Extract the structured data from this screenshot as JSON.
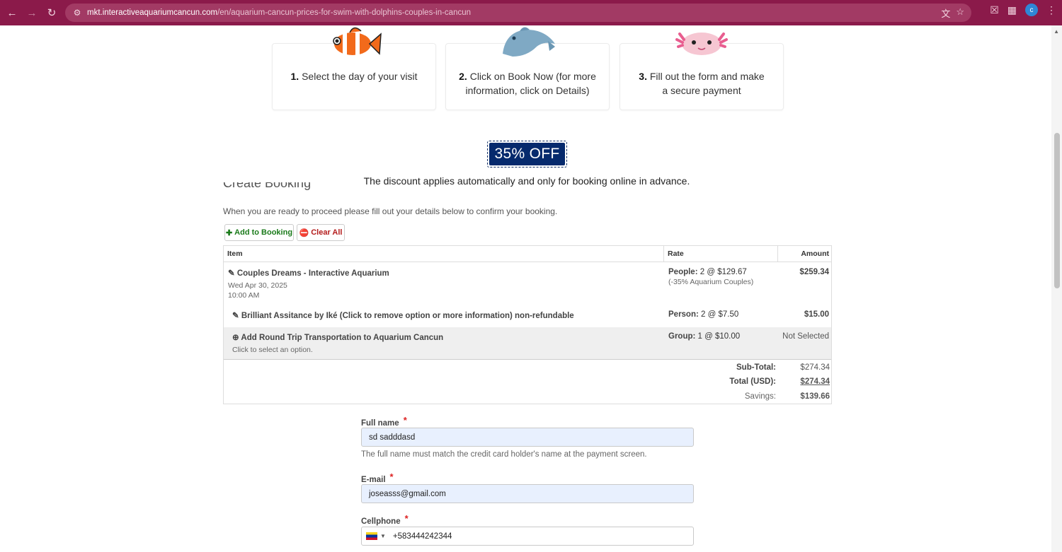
{
  "browser": {
    "url_host": "mkt.interactiveaquariumcancun.com",
    "url_path": "/en/aquarium-cancun-prices-for-swim-with-dolphins-couples-in-cancun",
    "profile_initial": "c"
  },
  "steps": [
    {
      "number": "1.",
      "text": "Select the day of your visit"
    },
    {
      "number": "2.",
      "text": "Click on Book Now (for more information, click on Details)"
    },
    {
      "number": "3.",
      "text": "Fill out the form and make a secure payment"
    }
  ],
  "promo": {
    "badge": "35% OFF",
    "note": "The discount applies automatically and only for booking online in advance."
  },
  "booking": {
    "heading": "Create Booking",
    "intro": "When you are ready to proceed please fill out your details below to confirm your booking.",
    "add_button": "Add to Booking",
    "clear_button": "Clear All",
    "columns": {
      "item": "Item",
      "rate": "Rate",
      "amount": "Amount"
    },
    "rows": [
      {
        "title": "Couples Dreams - Interactive Aquarium",
        "date": "Wed Apr 30, 2025",
        "time": "10:00 AM",
        "rate_label": "People:",
        "rate_value": "2 @ $129.67",
        "rate_note": "(-35% Aquarium Couples)",
        "amount": "$259.34"
      },
      {
        "title": "Brilliant Assitance by Iké (Click to remove option or more information) non-refundable",
        "rate_label": "Person:",
        "rate_value": "2 @ $7.50",
        "amount": "$15.00"
      },
      {
        "title": "Add Round Trip Transportation to Aquarium Cancun",
        "subtitle": "Click to select an option.",
        "rate_label": "Group:",
        "rate_value": "1 @ $10.00",
        "amount": "Not Selected"
      }
    ],
    "totals": {
      "subtotal_label": "Sub-Total:",
      "subtotal": "$274.34",
      "total_label": "Total (USD):",
      "total": "$274.34",
      "savings_label": "Savings:",
      "savings": "$139.66"
    }
  },
  "form": {
    "full_name_label": "Full name",
    "full_name_value": "sd sadddasd",
    "full_name_help": "The full name must match the credit card holder's name at the payment screen.",
    "email_label": "E-mail",
    "email_value": "joseasss@gmail.com",
    "cellphone_label": "Cellphone",
    "cellphone_value": "+583444242344",
    "required_mark": "*"
  },
  "colors": {
    "chrome": "#8b1a4a",
    "badge": "#062a6d",
    "add_green": "#1a7a1a",
    "clear_red": "#b41c1c"
  }
}
